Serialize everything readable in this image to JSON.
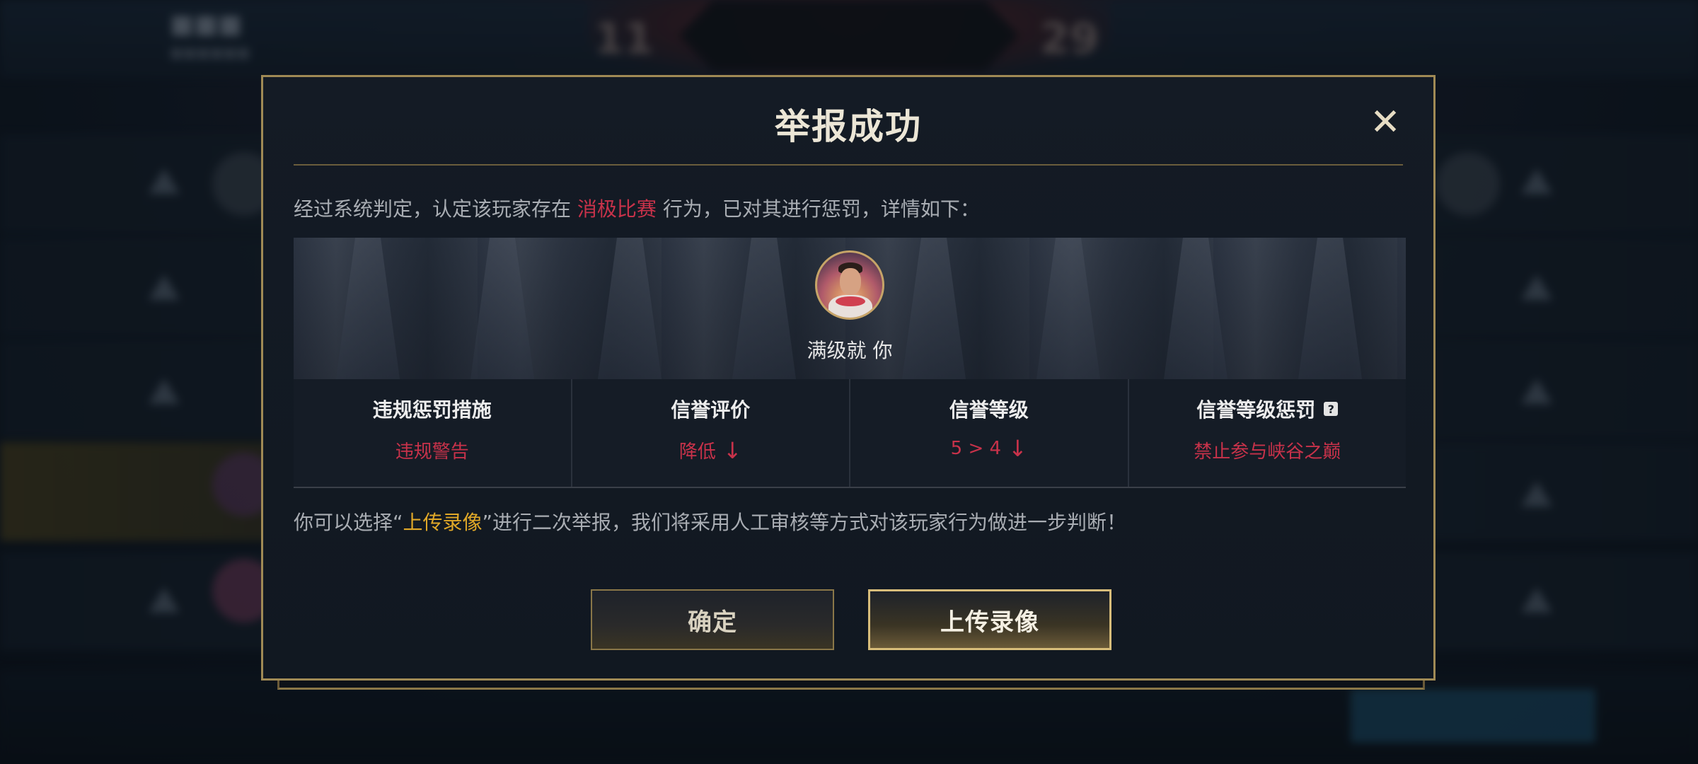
{
  "dialog": {
    "title": "举报成功",
    "close_glyph": "✕",
    "verdict": {
      "prefix": "经过系统判定，认定该玩家存在",
      "violation": "消极比赛",
      "suffix": "行为，已对其进行惩罚，详情如下："
    },
    "player": {
      "name": "满级就 你"
    },
    "stats": [
      {
        "label": "违规惩罚措施",
        "value": "违规警告",
        "arrow": ""
      },
      {
        "label": "信誉评价",
        "value": "降低",
        "arrow": "↓"
      },
      {
        "label": "信誉等级",
        "value": "5 > 4",
        "arrow": "↓"
      },
      {
        "label": "信誉等级惩罚",
        "value": "禁止参与峡谷之巅",
        "arrow": "",
        "help": "?"
      }
    ],
    "hint": {
      "prefix": "你可以选择“",
      "highlight": "上传录像",
      "suffix": "”进行二次举报，我们将采用人工审核等方式对该玩家行为做进一步判断！"
    },
    "buttons": {
      "confirm": "确定",
      "upload": "上传录像"
    }
  },
  "colors": {
    "accent_gold": "#a08a55",
    "violation_red": "#c8324a",
    "highlight_gold": "#e0a828"
  }
}
